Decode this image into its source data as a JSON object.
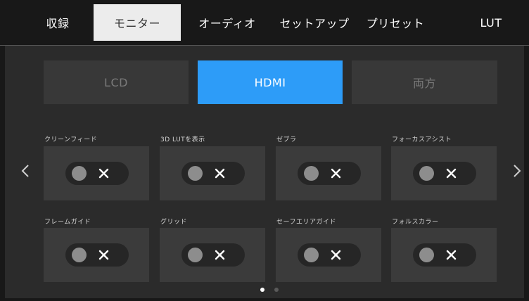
{
  "tabs": [
    {
      "label": "収録"
    },
    {
      "label": "モニター",
      "active": true
    },
    {
      "label": "オーディオ"
    },
    {
      "label": "セットアップ"
    },
    {
      "label": "プリセット"
    },
    {
      "label": "LUT"
    }
  ],
  "sources": [
    {
      "label": "LCD"
    },
    {
      "label": "HDMI",
      "active": true
    },
    {
      "label": "両方"
    }
  ],
  "toggles": [
    {
      "label": "クリーンフィード",
      "state": "off"
    },
    {
      "label": "3D LUTを表示",
      "state": "off"
    },
    {
      "label": "ゼブラ",
      "state": "off"
    },
    {
      "label": "フォーカスアシスト",
      "state": "off"
    },
    {
      "label": "フレームガイド",
      "state": "off"
    },
    {
      "label": "グリッド",
      "state": "off"
    },
    {
      "label": "セーフエリアガイド",
      "state": "off"
    },
    {
      "label": "フォルスカラー",
      "state": "off"
    }
  ],
  "pagination": {
    "current_page": 1,
    "total_pages": 2
  },
  "colors": {
    "accent": "#2d9cf8",
    "active_tab_bg": "#ececec",
    "tile_bg": "#3b3b3b",
    "background": "#2b2b2b"
  },
  "icons": {
    "prev": "chevron-left-icon",
    "next": "chevron-right-icon",
    "off": "x-icon"
  }
}
